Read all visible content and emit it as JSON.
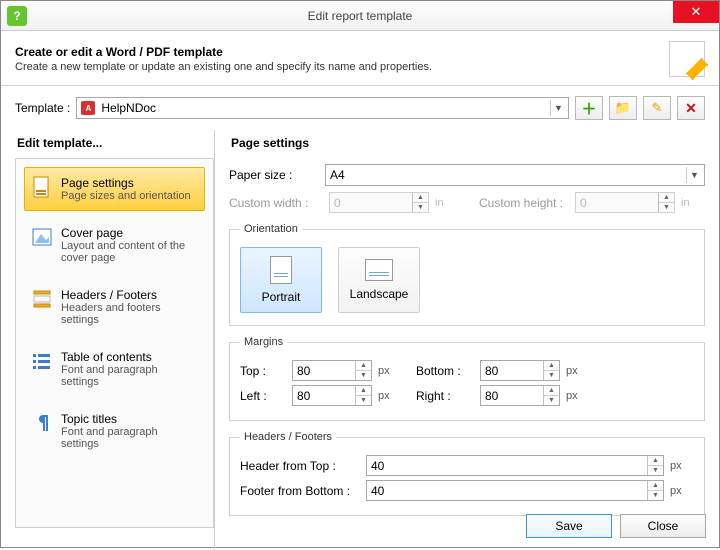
{
  "window": {
    "title": "Edit report template"
  },
  "header": {
    "title": "Create or edit a Word / PDF template",
    "subtitle": "Create a new template or update an existing one and specify its name and properties."
  },
  "templateRow": {
    "label": "Template :",
    "value": "HelpNDoc"
  },
  "leftHeader": "Edit template...",
  "nav": {
    "items": [
      {
        "title": "Page settings",
        "sub": "Page sizes and orientation"
      },
      {
        "title": "Cover page",
        "sub": "Layout and content of the cover page"
      },
      {
        "title": "Headers / Footers",
        "sub": "Headers and footers settings"
      },
      {
        "title": "Table of contents",
        "sub": "Font and paragraph settings"
      },
      {
        "title": "Topic titles",
        "sub": "Font and paragraph settings"
      }
    ]
  },
  "rightHeader": "Page settings",
  "page": {
    "paperSizeLabel": "Paper size :",
    "paperSize": "A4",
    "customWidthLabel": "Custom width :",
    "customWidth": "0",
    "customHeightLabel": "Custom height :",
    "customHeight": "0",
    "unit_in": "in",
    "unit_px": "px",
    "orientation": {
      "legend": "Orientation",
      "portrait": "Portrait",
      "landscape": "Landscape"
    },
    "margins": {
      "legend": "Margins",
      "topLabel": "Top :",
      "top": "80",
      "bottomLabel": "Bottom :",
      "bottom": "80",
      "leftLabel": "Left :",
      "left": "80",
      "rightLabel": "Right :",
      "right": "80"
    },
    "hf": {
      "legend": "Headers / Footers",
      "headerLabel": "Header from Top :",
      "header": "40",
      "footerLabel": "Footer from Bottom :",
      "footer": "40"
    }
  },
  "buttons": {
    "save": "Save",
    "close": "Close"
  }
}
